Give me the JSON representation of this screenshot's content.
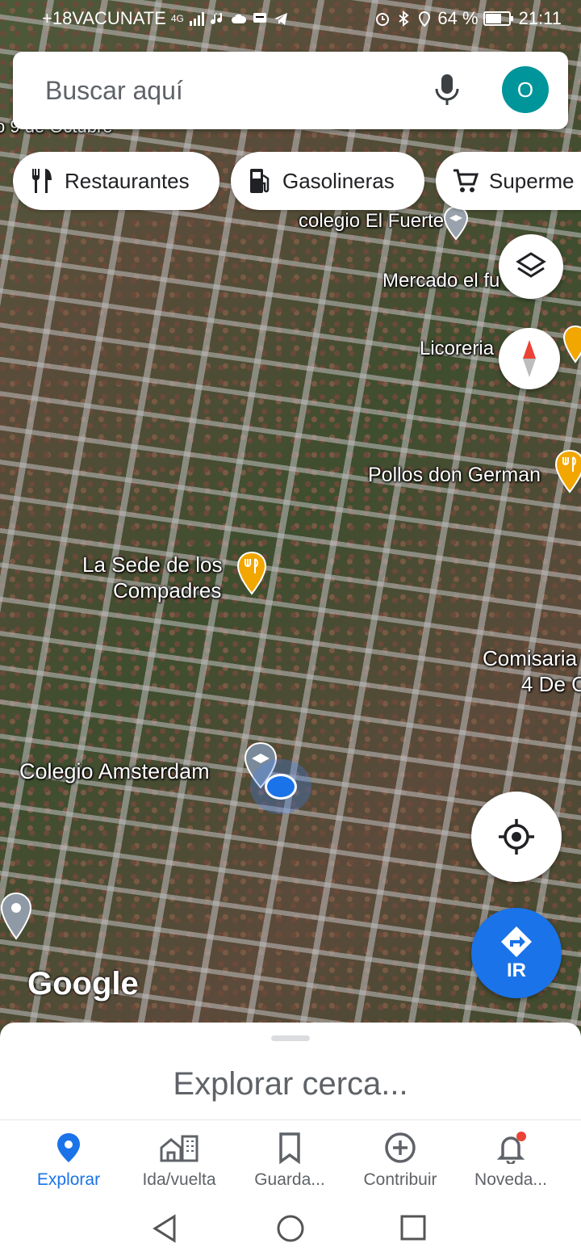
{
  "status_bar": {
    "left_text": "+18VACUNATE",
    "network": "4G",
    "battery": "64 %",
    "time": "21:11"
  },
  "search": {
    "placeholder": "Buscar aquí",
    "avatar_letter": "O"
  },
  "chips": [
    {
      "label": "Restaurantes",
      "icon": "fork-knife-icon"
    },
    {
      "label": "Gasolineras",
      "icon": "gas-pump-icon"
    },
    {
      "label": "Superme",
      "icon": "cart-icon"
    }
  ],
  "map_labels": {
    "street_top": "o 9 de Octubre",
    "colegio_fuerte": "colegio El Fuerte",
    "mercado": "Mercado el fu",
    "licoreria": "Licoreria",
    "pollos": "Pollos don German",
    "sede_line1": "La Sede de los",
    "sede_line2": "Compadres",
    "comisaria_line1": "Comisaria",
    "comisaria_line2": "4 De O",
    "colegio_amsterdam": "Colegio Amsterdam"
  },
  "google_logo": "Google",
  "go_button": "IR",
  "bottom_sheet": {
    "title": "Explorar cerca..."
  },
  "nav": [
    {
      "label": "Explorar",
      "icon": "location-pin-icon",
      "active": true
    },
    {
      "label": "Ida/vuelta",
      "icon": "commute-icon",
      "active": false
    },
    {
      "label": "Guarda...",
      "icon": "bookmark-icon",
      "active": false
    },
    {
      "label": "Contribuir",
      "icon": "add-circle-icon",
      "active": false
    },
    {
      "label": "Noveda...",
      "icon": "bell-icon",
      "active": false
    }
  ],
  "colors": {
    "accent": "#1a73e8",
    "avatar": "#00959a",
    "restaurant_pin": "#f2a600"
  }
}
